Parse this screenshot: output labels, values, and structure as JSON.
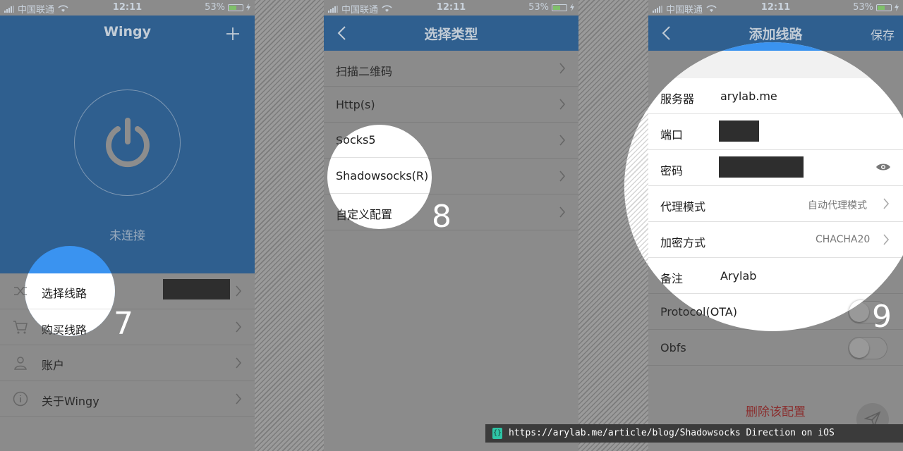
{
  "status": {
    "carrier": "中国联通",
    "time": "12:11",
    "battery": "53%",
    "battery_level": 0.53
  },
  "screen1": {
    "title": "Wingy",
    "connection_state": "未连接",
    "menu": [
      {
        "label": "选择线路",
        "icon": "shuffle-icon"
      },
      {
        "label": "购买线路",
        "icon": "cart-icon"
      },
      {
        "label": "账户",
        "icon": "user-icon"
      },
      {
        "label": "关于Wingy",
        "icon": "info-icon"
      }
    ],
    "step": "7"
  },
  "screen2": {
    "title": "选择类型",
    "options": [
      "扫描二维码",
      "Http(s)",
      "Socks5",
      "Shadowsocks(R)",
      "自定义配置"
    ],
    "step": "8"
  },
  "screen3": {
    "title": "添加线路",
    "save_label": "保存",
    "server_label": "服务器",
    "server_value": "arylab.me",
    "port_label": "端口",
    "password_label": "密码",
    "proxy_mode_label": "代理模式",
    "proxy_mode_value": "自动代理模式",
    "encryption_label": "加密方式",
    "encryption_value": "CHACHA20",
    "note_label": "备注",
    "note_value": "Arylab",
    "ota_label": "Protocol(OTA)",
    "obfs_label": "Obfs",
    "delete_label": "删除该配置",
    "step": "9"
  },
  "caption": {
    "url": "https://arylab.me/article/blog/Shadowsocks Direction on iOS"
  },
  "colors": {
    "nav": "#2f5f8f",
    "spotlight_blue": "#3a93f0",
    "delete_red": "#8a2e2e"
  }
}
